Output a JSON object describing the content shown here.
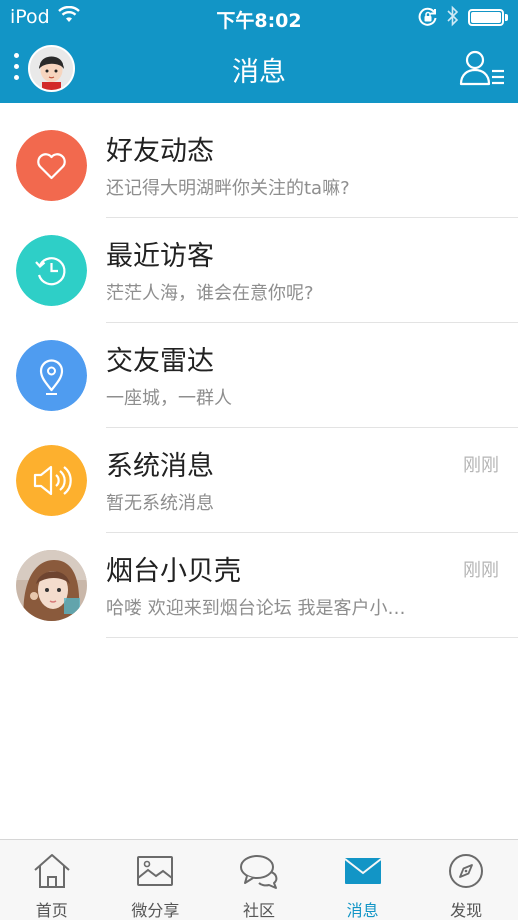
{
  "status_bar": {
    "carrier": "iPod",
    "time": "下午8:02"
  },
  "nav": {
    "title": "消息",
    "left_icons": [
      "dots-icon",
      "avatar"
    ],
    "right_icon": "contacts-menu-icon"
  },
  "colors": {
    "brand": "#1295c6",
    "friends_activity": "#f2694e",
    "recent_visitors": "#2ecfc7",
    "radar": "#4f9cf0",
    "system": "#fdb02e"
  },
  "items": [
    {
      "icon": "heart-icon",
      "title": "好友动态",
      "subtitle": "还记得大明湖畔你关注的ta嘛?",
      "time": ""
    },
    {
      "icon": "clock-history-icon",
      "title": "最近访客",
      "subtitle": "茫茫人海，谁会在意你呢?",
      "time": ""
    },
    {
      "icon": "location-pin-icon",
      "title": "交友雷达",
      "subtitle": "一座城，一群人",
      "time": ""
    },
    {
      "icon": "speaker-icon",
      "title": "系统消息",
      "subtitle": "暂无系统消息",
      "time": "刚刚"
    },
    {
      "icon": "user-avatar",
      "title": "烟台小贝壳",
      "subtitle": "哈喽 欢迎来到烟台论坛 我是客户小…",
      "time": "刚刚"
    }
  ],
  "tabs": [
    {
      "icon": "home-icon",
      "label": "首页",
      "active": false
    },
    {
      "icon": "image-icon",
      "label": "微分享",
      "active": false
    },
    {
      "icon": "chat-bubbles-icon",
      "label": "社区",
      "active": false
    },
    {
      "icon": "envelope-icon",
      "label": "消息",
      "active": true
    },
    {
      "icon": "compass-icon",
      "label": "发现",
      "active": false
    }
  ]
}
